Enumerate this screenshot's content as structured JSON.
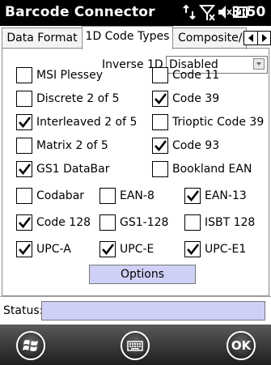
{
  "app": {
    "title": "Barcode Connector",
    "clock": "3:50"
  },
  "tabs": [
    {
      "label": "Data Format",
      "active": false
    },
    {
      "label": "1D Code Types",
      "active": true
    },
    {
      "label": "Composite/F",
      "active": false
    }
  ],
  "inverse": {
    "label": "Inverse 1D",
    "value": "Disabled"
  },
  "checkboxes": [
    {
      "label": "MSI Plessey",
      "checked": false
    },
    {
      "label": "Code 11",
      "checked": false
    },
    {
      "label": "Discrete 2 of 5",
      "checked": false
    },
    {
      "label": "Code 39",
      "checked": true
    },
    {
      "label": "Interleaved 2 of 5",
      "checked": true
    },
    {
      "label": "Trioptic Code 39",
      "checked": false
    },
    {
      "label": "Matrix 2 of 5",
      "checked": false
    },
    {
      "label": "Code 93",
      "checked": true
    },
    {
      "label": "GS1 DataBar",
      "checked": true
    },
    {
      "label": "Bookland EAN",
      "checked": false
    },
    {
      "label": "Codabar",
      "checked": false
    },
    {
      "label": "EAN-8",
      "checked": false
    },
    {
      "label": "EAN-13",
      "checked": true
    },
    {
      "label": "Code 128",
      "checked": true
    },
    {
      "label": "GS1-128",
      "checked": false
    },
    {
      "label": "ISBT 128",
      "checked": false
    },
    {
      "label": "UPC-A",
      "checked": true
    },
    {
      "label": "UPC-E",
      "checked": true
    },
    {
      "label": "UPC-E1",
      "checked": true
    }
  ],
  "options_button": "Options",
  "status": {
    "label": "Status:",
    "value": ""
  },
  "bottombar": {
    "ok_label": "OK"
  },
  "icons": {
    "connection": "sync-arrows-icon",
    "signal": "no-signal-icon",
    "volume": "speaker-off-icon",
    "battery": "battery-icon",
    "start": "windows-start-icon",
    "keyboard": "keyboard-icon"
  }
}
